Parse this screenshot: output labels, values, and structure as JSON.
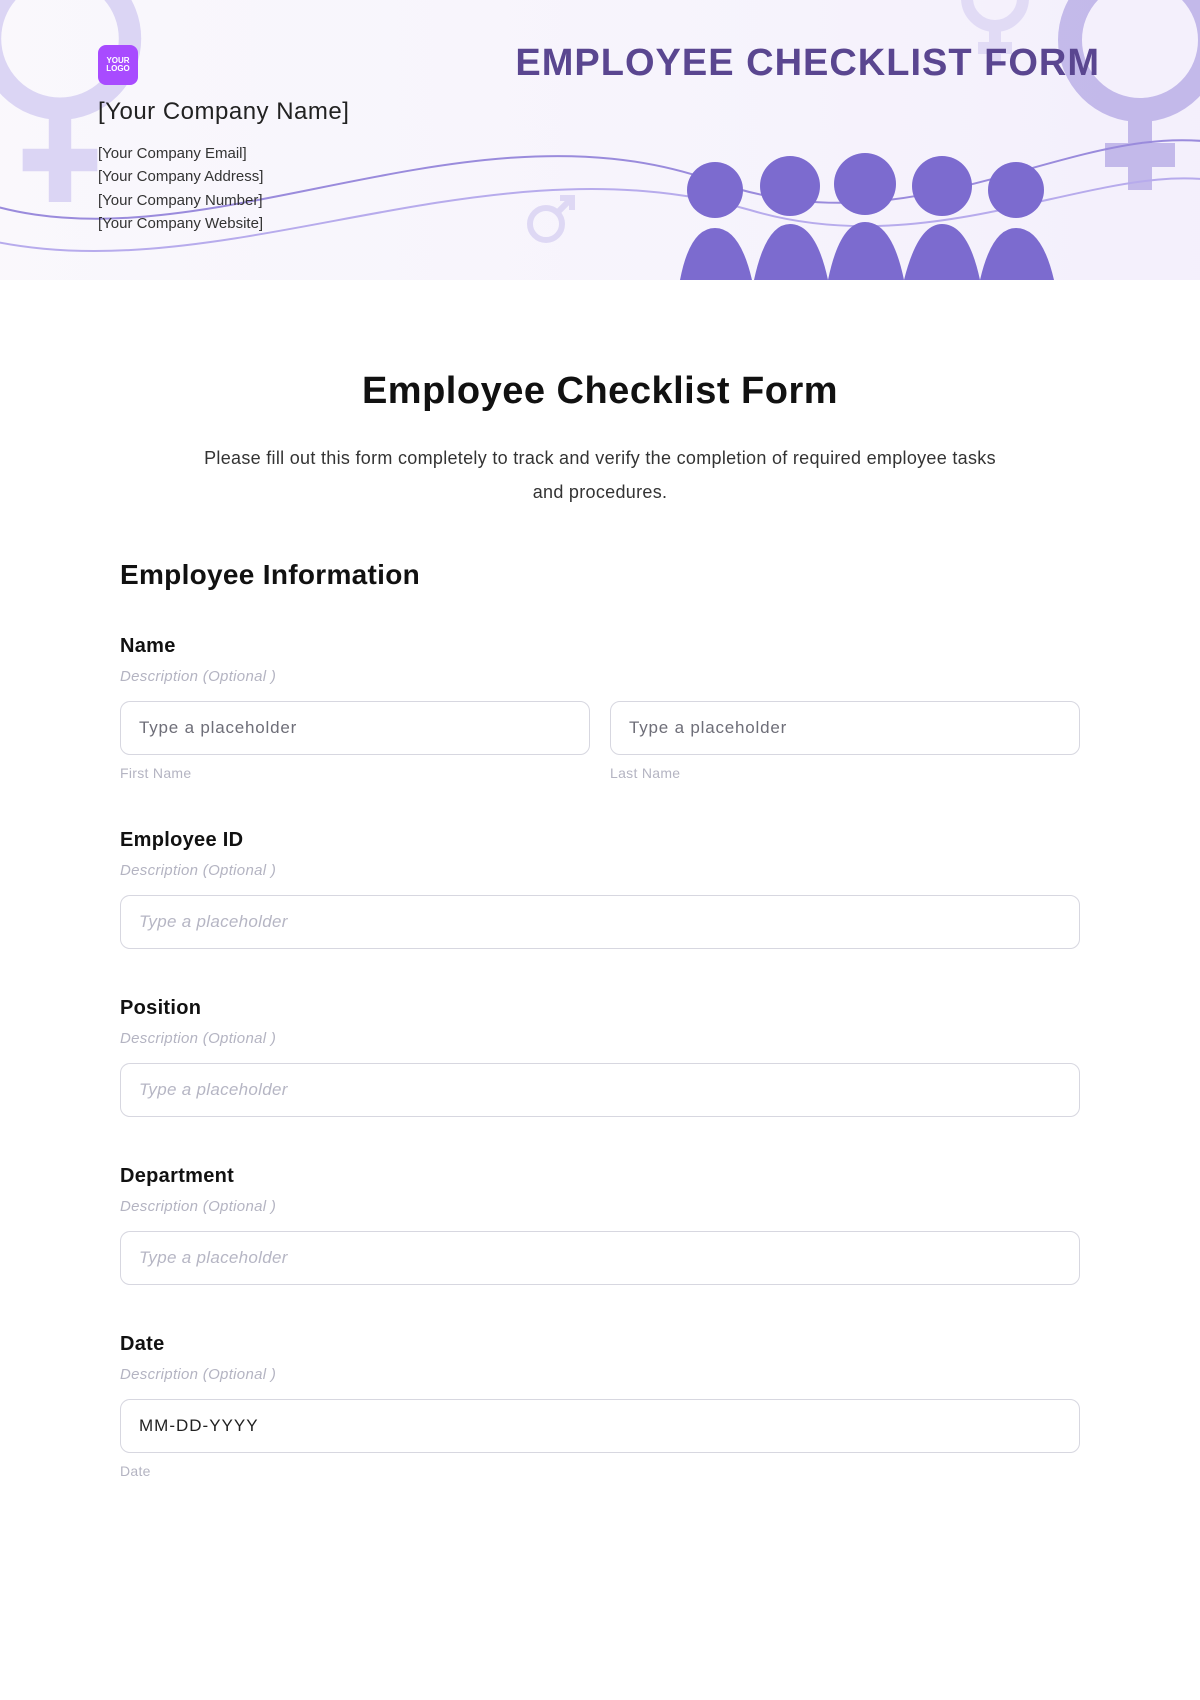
{
  "header": {
    "logo_text": "YOUR LOGO",
    "company_name": "[Your Company Name]",
    "company_email": "[Your Company Email]",
    "company_address": "[Your Company Address]",
    "company_number": "[Your Company Number]",
    "company_website": "[Your Company Website]",
    "banner_title": "EMPLOYEE CHECKLIST FORM"
  },
  "form": {
    "title": "Employee Checklist Form",
    "intro": "Please fill out this form completely to track and verify the completion of required employee tasks and procedures.",
    "section_heading": "Employee Information",
    "desc_hint": "Description (Optional )",
    "fields": {
      "name": {
        "label": "Name",
        "first_placeholder": "Type a placeholder",
        "last_placeholder": "Type a placeholder",
        "first_sub": "First Name",
        "last_sub": "Last Name"
      },
      "employee_id": {
        "label": "Employee ID",
        "placeholder": "Type a placeholder"
      },
      "position": {
        "label": "Position",
        "placeholder": "Type a placeholder"
      },
      "department": {
        "label": "Department",
        "placeholder": "Type a placeholder"
      },
      "date": {
        "label": "Date",
        "placeholder": "MM-DD-YYYY",
        "sub": "Date"
      }
    }
  }
}
